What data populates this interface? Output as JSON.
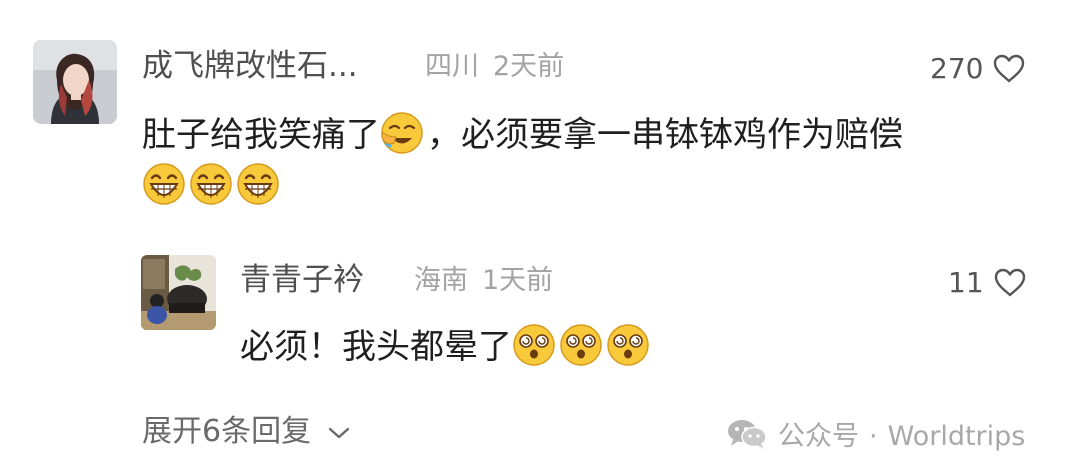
{
  "comment": {
    "username": "成飞牌改性石...",
    "location": "四川",
    "time": "2天前",
    "likes": "270",
    "text": "肚子给我笑痛了",
    "text_after_emoji": "，必须要拿一串钵钵鸡作为赔偿",
    "inline_emoji": "face-with-tears-emoji",
    "trailing_emojis": [
      "grinning-face-emoji",
      "grinning-face-emoji",
      "grinning-face-emoji"
    ]
  },
  "reply": {
    "username": "青青子衿",
    "location": "海南",
    "time": "1天前",
    "likes": "11",
    "text": "必须！我头都晕了",
    "trailing_emojis": [
      "dizzy-face-emoji",
      "dizzy-face-emoji",
      "dizzy-face-emoji"
    ]
  },
  "expand_replies": {
    "label": "展开6条回复",
    "icon": "chevron-down-icon"
  },
  "watermark": {
    "prefix": "公众号",
    "dot": "·",
    "name": "Worldtrips",
    "icon": "wechat-icon"
  },
  "colors": {
    "username": "#4f4f4f",
    "meta": "#a3a3a3",
    "body_text": "#1f1f1f",
    "emoji_yellow": "#f9c93c"
  }
}
